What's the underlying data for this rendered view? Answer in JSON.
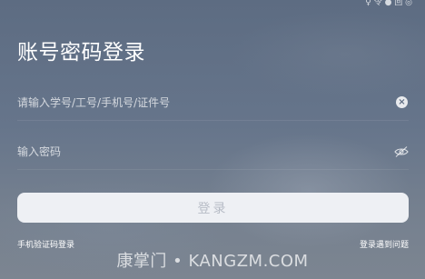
{
  "status_bar": {
    "fragment": "♀ 令 ● 回 ◎"
  },
  "login": {
    "title": "账号密码登录",
    "username": {
      "value": "",
      "placeholder": "请输入学号/工号/手机号/证件号"
    },
    "password": {
      "value": "",
      "placeholder": "输入密码"
    },
    "submit_label": "登录"
  },
  "links": {
    "sms_login": "手机验证码登录",
    "problem": "登录遇到问题"
  },
  "watermark": "康掌门 • KANGZM.COM",
  "icons": {
    "clear": "clear-icon",
    "password_visibility": "eye-off-icon"
  },
  "colors": {
    "background": "#66758b",
    "button_background": "#eef0f4",
    "button_text": "#b7bcc6"
  }
}
